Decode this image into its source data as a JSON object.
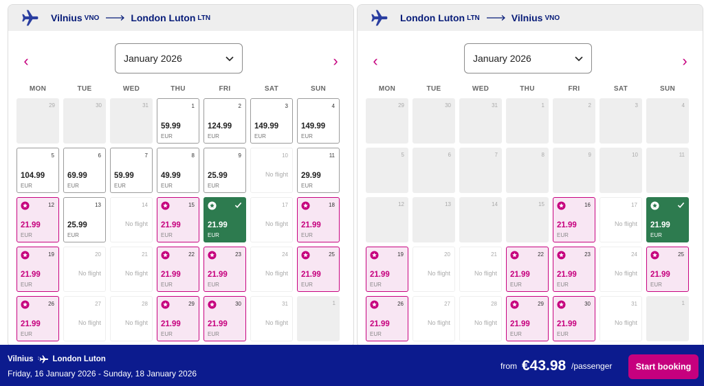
{
  "outbound": {
    "from_city": "Vilnius",
    "from_code": "VNO",
    "to_city": "London Luton",
    "to_code": "LTN",
    "month": "January 2026",
    "weekdays": [
      "MON",
      "TUE",
      "WED",
      "THU",
      "FRI",
      "SAT",
      "SUN"
    ],
    "days": [
      {
        "day": "29",
        "state": "disabled"
      },
      {
        "day": "30",
        "state": "disabled"
      },
      {
        "day": "31",
        "state": "disabled"
      },
      {
        "day": "1",
        "state": "price",
        "price": "59.99",
        "currency": "EUR"
      },
      {
        "day": "2",
        "state": "price",
        "price": "124.99",
        "currency": "EUR"
      },
      {
        "day": "3",
        "state": "price",
        "price": "149.99",
        "currency": "EUR"
      },
      {
        "day": "4",
        "state": "price",
        "price": "149.99",
        "currency": "EUR"
      },
      {
        "day": "5",
        "state": "price",
        "price": "104.99",
        "currency": "EUR"
      },
      {
        "day": "6",
        "state": "price",
        "price": "69.99",
        "currency": "EUR"
      },
      {
        "day": "7",
        "state": "price",
        "price": "59.99",
        "currency": "EUR"
      },
      {
        "day": "8",
        "state": "price",
        "price": "49.99",
        "currency": "EUR"
      },
      {
        "day": "9",
        "state": "price",
        "price": "25.99",
        "currency": "EUR"
      },
      {
        "day": "10",
        "state": "noflight",
        "label": "No flight"
      },
      {
        "day": "11",
        "state": "price",
        "price": "29.99",
        "currency": "EUR"
      },
      {
        "day": "12",
        "state": "promo",
        "price": "21.99",
        "currency": "EUR"
      },
      {
        "day": "13",
        "state": "price",
        "price": "25.99",
        "currency": "EUR"
      },
      {
        "day": "14",
        "state": "noflight",
        "label": "No flight"
      },
      {
        "day": "15",
        "state": "promo",
        "price": "21.99",
        "currency": "EUR"
      },
      {
        "day": "16",
        "state": "selected",
        "price": "21.99",
        "currency": "EUR"
      },
      {
        "day": "17",
        "state": "noflight",
        "label": "No flight"
      },
      {
        "day": "18",
        "state": "promo",
        "price": "21.99",
        "currency": "EUR"
      },
      {
        "day": "19",
        "state": "promo",
        "price": "21.99",
        "currency": "EUR"
      },
      {
        "day": "20",
        "state": "noflight",
        "label": "No flight"
      },
      {
        "day": "21",
        "state": "noflight",
        "label": "No flight"
      },
      {
        "day": "22",
        "state": "promo",
        "price": "21.99",
        "currency": "EUR"
      },
      {
        "day": "23",
        "state": "promo",
        "price": "21.99",
        "currency": "EUR"
      },
      {
        "day": "24",
        "state": "noflight",
        "label": "No flight"
      },
      {
        "day": "25",
        "state": "promo",
        "price": "21.99",
        "currency": "EUR"
      },
      {
        "day": "26",
        "state": "promo",
        "price": "21.99",
        "currency": "EUR"
      },
      {
        "day": "27",
        "state": "noflight",
        "label": "No flight"
      },
      {
        "day": "28",
        "state": "noflight",
        "label": "No flight"
      },
      {
        "day": "29",
        "state": "promo",
        "price": "21.99",
        "currency": "EUR"
      },
      {
        "day": "30",
        "state": "promo",
        "price": "21.99",
        "currency": "EUR"
      },
      {
        "day": "31",
        "state": "noflight",
        "label": "No flight"
      },
      {
        "day": "1",
        "state": "disabled"
      }
    ]
  },
  "return": {
    "from_city": "London Luton",
    "from_code": "LTN",
    "to_city": "Vilnius",
    "to_code": "VNO",
    "month": "January 2026",
    "weekdays": [
      "MON",
      "TUE",
      "WED",
      "THU",
      "FRI",
      "SAT",
      "SUN"
    ],
    "days": [
      {
        "day": "29",
        "state": "disabled"
      },
      {
        "day": "30",
        "state": "disabled"
      },
      {
        "day": "31",
        "state": "disabled"
      },
      {
        "day": "1",
        "state": "disabled"
      },
      {
        "day": "2",
        "state": "disabled"
      },
      {
        "day": "3",
        "state": "disabled"
      },
      {
        "day": "4",
        "state": "disabled"
      },
      {
        "day": "5",
        "state": "disabled"
      },
      {
        "day": "6",
        "state": "disabled"
      },
      {
        "day": "7",
        "state": "disabled"
      },
      {
        "day": "8",
        "state": "disabled"
      },
      {
        "day": "9",
        "state": "disabled"
      },
      {
        "day": "10",
        "state": "disabled"
      },
      {
        "day": "11",
        "state": "disabled"
      },
      {
        "day": "12",
        "state": "disabled"
      },
      {
        "day": "13",
        "state": "disabled"
      },
      {
        "day": "14",
        "state": "disabled"
      },
      {
        "day": "15",
        "state": "disabled"
      },
      {
        "day": "16",
        "state": "promo",
        "price": "21.99",
        "currency": "EUR"
      },
      {
        "day": "17",
        "state": "noflight",
        "label": "No flight"
      },
      {
        "day": "18",
        "state": "selected",
        "price": "21.99",
        "currency": "EUR"
      },
      {
        "day": "19",
        "state": "promo",
        "price": "21.99",
        "currency": "EUR"
      },
      {
        "day": "20",
        "state": "noflight",
        "label": "No flight"
      },
      {
        "day": "21",
        "state": "noflight",
        "label": "No flight"
      },
      {
        "day": "22",
        "state": "promo",
        "price": "21.99",
        "currency": "EUR"
      },
      {
        "day": "23",
        "state": "promo",
        "price": "21.99",
        "currency": "EUR"
      },
      {
        "day": "24",
        "state": "noflight",
        "label": "No flight"
      },
      {
        "day": "25",
        "state": "promo",
        "price": "21.99",
        "currency": "EUR"
      },
      {
        "day": "26",
        "state": "promo",
        "price": "21.99",
        "currency": "EUR"
      },
      {
        "day": "27",
        "state": "noflight",
        "label": "No flight"
      },
      {
        "day": "28",
        "state": "noflight",
        "label": "No flight"
      },
      {
        "day": "29",
        "state": "promo",
        "price": "21.99",
        "currency": "EUR"
      },
      {
        "day": "30",
        "state": "promo",
        "price": "21.99",
        "currency": "EUR"
      },
      {
        "day": "31",
        "state": "noflight",
        "label": "No flight"
      },
      {
        "day": "1",
        "state": "disabled"
      }
    ]
  },
  "footer": {
    "from_city": "Vilnius",
    "to_city": "London Luton",
    "dates": "Friday, 16 January 2026 - Sunday, 18 January 2026",
    "from_label": "from",
    "price": "€43.98",
    "per_label": "/passenger",
    "cta": "Start booking"
  },
  "colors": {
    "brand_navy": "#0c1b8e",
    "accent_pink": "#c6007e",
    "selected_green": "#2d7b4f"
  },
  "icons": {
    "plane": "plane-icon",
    "arrow": "route-arrow-icon",
    "prev": "chevron-left-icon",
    "next": "chevron-right-icon",
    "dropdown": "chevron-down-icon",
    "promo": "star-badge-icon",
    "check": "check-icon"
  }
}
